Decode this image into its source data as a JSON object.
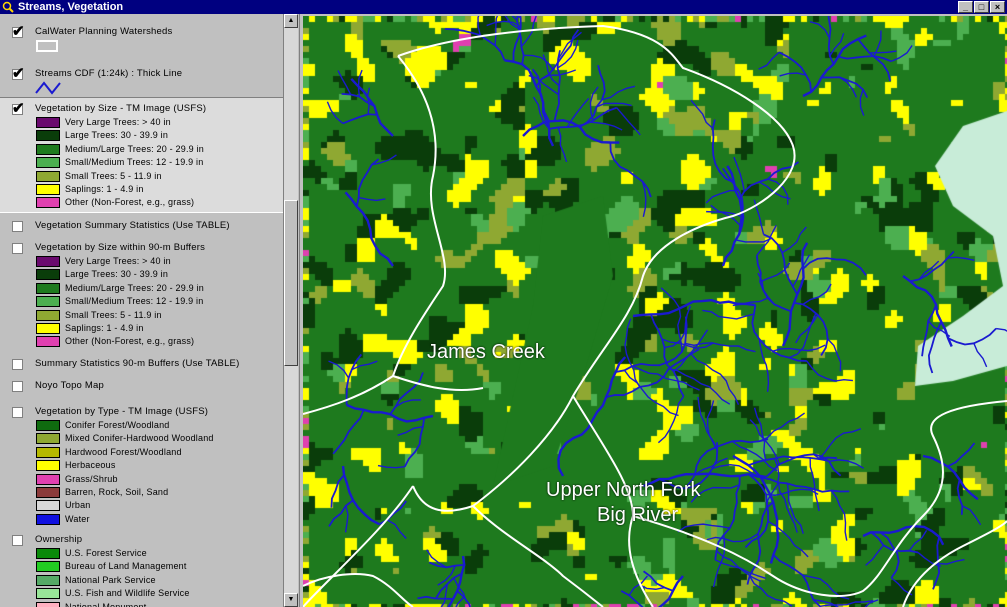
{
  "window": {
    "title": "Streams, Vegetation",
    "buttons": [
      "_",
      "□",
      "×"
    ]
  },
  "toc": {
    "themes": [
      {
        "name": "CalWater Planning Watersheds",
        "checked": true,
        "symbol": "polygon-outline"
      },
      {
        "name": "Streams CDF (1:24k) : Thick Line",
        "checked": true,
        "symbol": "line"
      },
      {
        "name": "Vegetation by Size - TM Image (USFS)",
        "checked": true,
        "selected": true,
        "legend": [
          {
            "label": "Very Large Trees: > 40  in",
            "color": "#6a0a6e"
          },
          {
            "label": "Large Trees: 30 - 39.9 in",
            "color": "#0a3d0a"
          },
          {
            "label": "Medium/Large Trees: 20 - 29.9 in",
            "color": "#1e7a1e"
          },
          {
            "label": "Small/Medium Trees: 12 - 19.9 in",
            "color": "#4caf50"
          },
          {
            "label": "Small Trees: 5 - 11.9 in",
            "color": "#8fa832"
          },
          {
            "label": "Saplings: 1 - 4.9 in",
            "color": "#ffff00"
          },
          {
            "label": "Other (Non-Forest, e.g., grass)",
            "color": "#e040b0"
          }
        ]
      },
      {
        "name": "Vegetation Summary Statistics (Use TABLE)",
        "checked": false
      },
      {
        "name": "Vegetation by Size within 90-m Buffers",
        "checked": false,
        "legend": [
          {
            "label": "Very Large Trees: > 40  in",
            "color": "#6a0a6e"
          },
          {
            "label": "Large Trees: 30 - 39.9 in",
            "color": "#0a3d0a"
          },
          {
            "label": "Medium/Large Trees: 20 - 29.9 in",
            "color": "#1e7a1e"
          },
          {
            "label": "Small/Medium Trees: 12 - 19.9 in",
            "color": "#4caf50"
          },
          {
            "label": "Small Trees: 5 - 11.9 in",
            "color": "#8fa832"
          },
          {
            "label": "Saplings: 1 - 4.9 in",
            "color": "#ffff00"
          },
          {
            "label": "Other (Non-Forest, e.g., grass)",
            "color": "#e040b0"
          }
        ]
      },
      {
        "name": "Summary Statistics 90-m Buffers (Use TABLE)",
        "checked": false
      },
      {
        "name": "Noyo Topo Map",
        "checked": false
      },
      {
        "name": "Vegetation by Type - TM Image (USFS)",
        "checked": false,
        "legend": [
          {
            "label": "Conifer Forest/Woodland",
            "color": "#0f6b0f"
          },
          {
            "label": "Mixed Conifer-Hardwood Woodland",
            "color": "#8fa832"
          },
          {
            "label": "Hardwood Forest/Woodland",
            "color": "#b5b800"
          },
          {
            "label": "Herbaceous",
            "color": "#ffff00"
          },
          {
            "label": "Grass/Shrub",
            "color": "#e040b0"
          },
          {
            "label": "Barren, Rock, Soil, Sand",
            "color": "#8b3a3a"
          },
          {
            "label": "Urban",
            "color": "#d8d8d8"
          },
          {
            "label": "Water",
            "color": "#1010e0"
          }
        ]
      },
      {
        "name": "Ownership",
        "checked": false,
        "legend": [
          {
            "label": "U.S. Forest Service",
            "color": "#0a8a0a"
          },
          {
            "label": "Bureau of Land Management",
            "color": "#22cc22"
          },
          {
            "label": "National Park Service",
            "color": "#55aa66"
          },
          {
            "label": "U.S. Fish and Wildlife Service",
            "color": "#99e699"
          },
          {
            "label": "National Monument",
            "color": "#ffb0c0"
          }
        ]
      }
    ]
  },
  "map": {
    "labels": [
      "James Creek",
      "Upper North Fork",
      "Big River"
    ],
    "colors": {
      "stream": "#1a1ad0",
      "boundary": "#ffffff",
      "water": "#c8ecd8"
    }
  }
}
